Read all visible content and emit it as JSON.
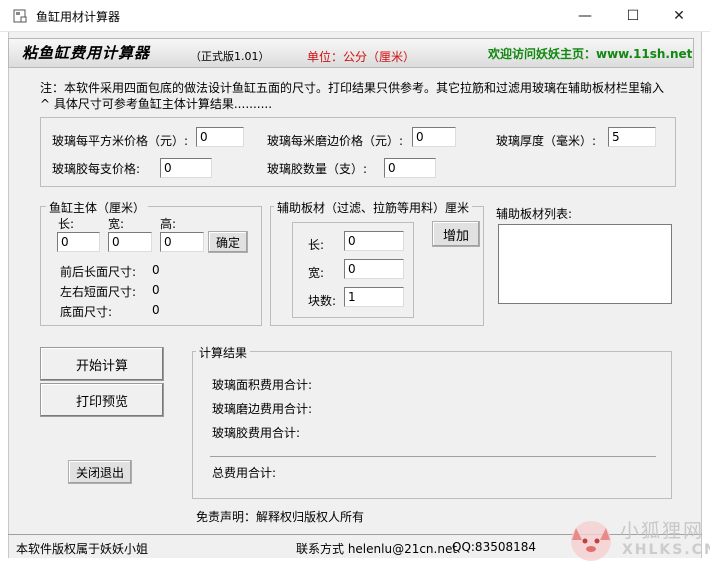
{
  "window": {
    "title": "鱼缸用材计算器",
    "minimize_glyph": "—",
    "maximize_glyph": "☐",
    "close_glyph": "✕"
  },
  "header": {
    "title": "粘鱼缸费用计算器",
    "version": "（正式版1.01）",
    "unit": "单位：公分（厘米）",
    "welcome": "欢迎访问妖妖主页：www.11sh.net"
  },
  "notes": {
    "line1": "注：本软件采用四面包底的做法设计鱼缸五面的尺寸。打印结果只供参考。其它拉筋和过滤用玻璃在辅助板材栏里输入",
    "line2": "^    具体尺寸可参考鱼缸主体计算结果.........."
  },
  "prices": {
    "sqm_price_label": "玻璃每平方米价格（元）:",
    "sqm_price_value": "0",
    "edge_price_label": "玻璃每米磨边价格（元）:",
    "edge_price_value": "0",
    "thickness_label": "玻璃厚度（毫米）:",
    "thickness_value": "5",
    "glue_price_label": "玻璃胶每支价格:",
    "glue_price_value": "0",
    "glue_count_label": "玻璃胶数量（支）:",
    "glue_count_value": "0"
  },
  "main_body": {
    "title": "鱼缸主体（厘米）",
    "length_label": "长:",
    "width_label": "宽:",
    "height_label": "高:",
    "length_value": "0",
    "width_value": "0",
    "height_value": "0",
    "confirm_label": "确定",
    "front_back_label": "前后长面尺寸:",
    "front_back_value": "0",
    "left_right_label": "左右短面尺寸:",
    "left_right_value": "0",
    "bottom_label": "底面尺寸:",
    "bottom_value": "0"
  },
  "aux": {
    "title": "辅助板材（过滤、拉筋等用料）厘米",
    "length_label": "长:",
    "width_label": "宽:",
    "count_label": "块数:",
    "length_value": "0",
    "width_value": "0",
    "count_value": "1",
    "add_label": "增加",
    "list_label": "辅助板材列表:"
  },
  "actions": {
    "start_label": "开始计算",
    "print_label": "打印预览",
    "exit_label": "关闭退出"
  },
  "results": {
    "title": "计算结果",
    "area_cost": "玻璃面积费用合计:",
    "edge_cost": "玻璃磨边费用合计:",
    "glue_cost": "玻璃胶费用合计:",
    "total_cost": "总费用合计:"
  },
  "disclaimer": "免责声明：解释权归版权人所有",
  "footer": {
    "copyright": "本软件版权属于妖妖小姐",
    "contact": "联系方式  helenlu@21cn.net",
    "qq": "QQ:83508184"
  },
  "watermark": {
    "cn": "小狐狸网",
    "en": "XHLKS.CN"
  },
  "colors": {
    "unit": "#d01010",
    "welcome": "#118811"
  }
}
